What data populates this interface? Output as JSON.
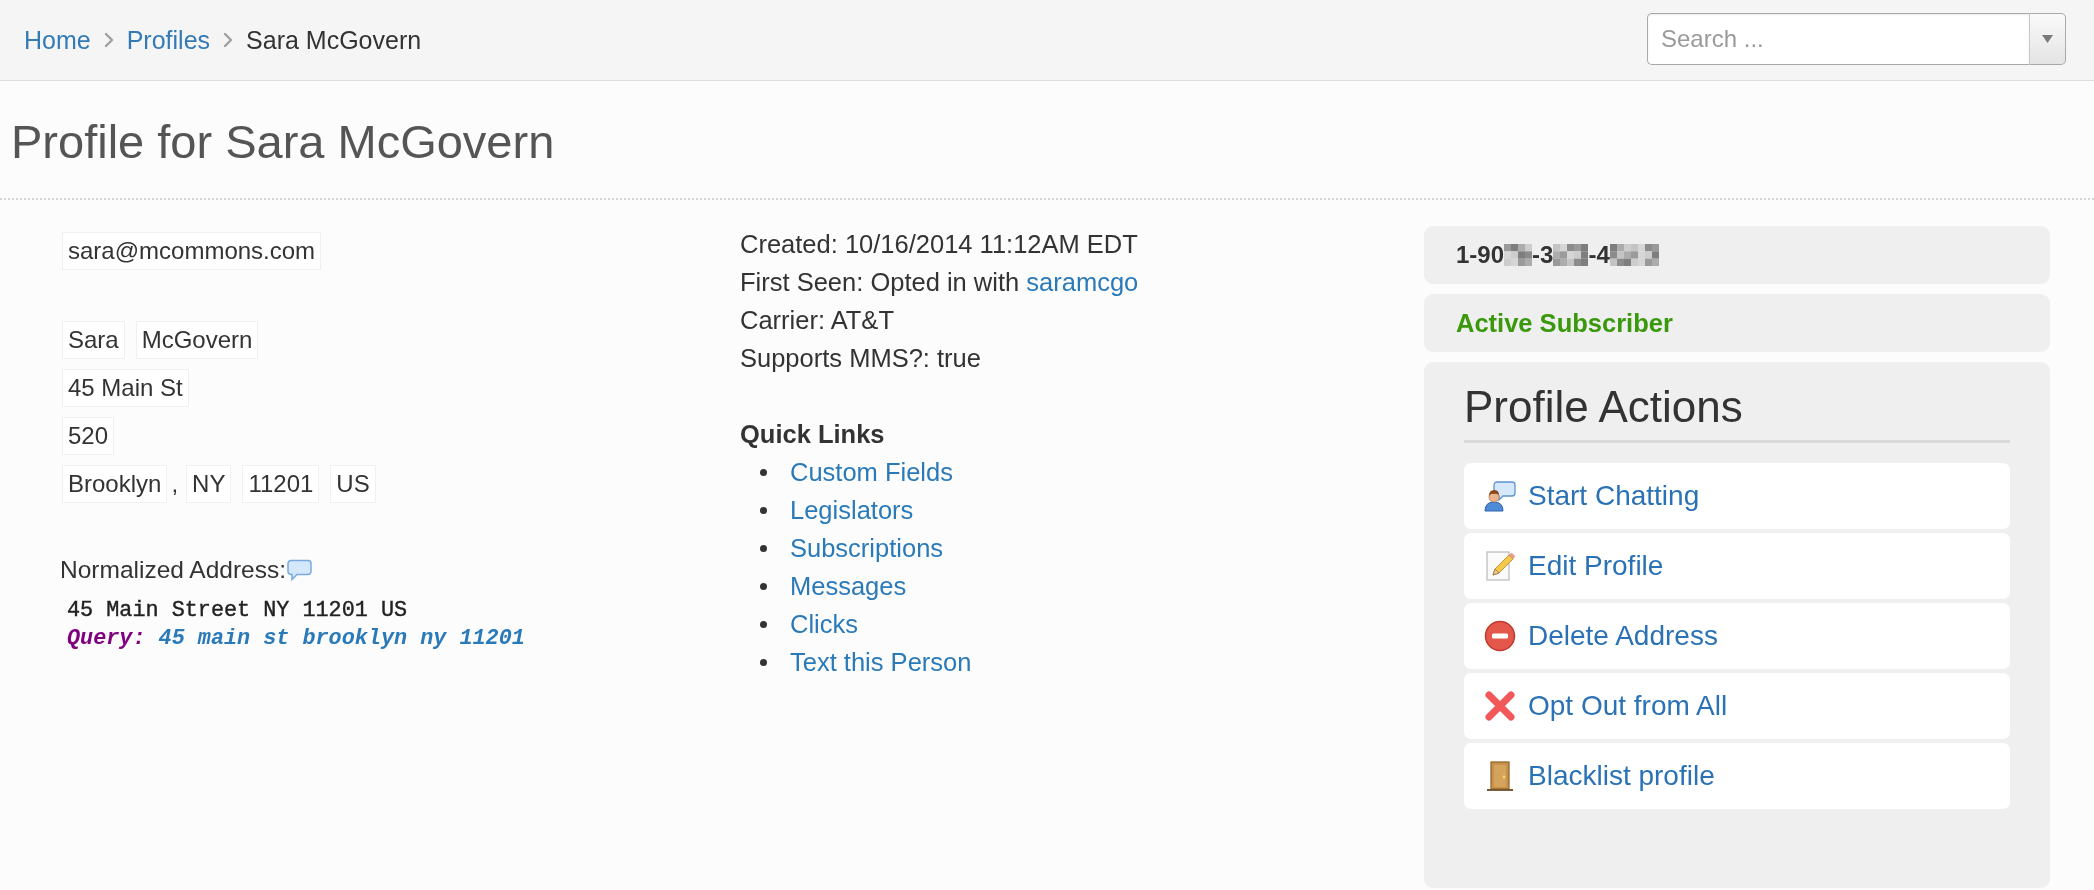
{
  "breadcrumb": [
    {
      "label": "Home",
      "kind": "link"
    },
    {
      "label": "Profiles",
      "kind": "link"
    },
    {
      "label": "Sara McGovern",
      "kind": "current"
    }
  ],
  "search": {
    "placeholder": "Search ..."
  },
  "page_title": "Profile for Sara McGovern",
  "contact": {
    "email": "sara@mcommons.com",
    "first_name": "Sara",
    "last_name": "McGovern",
    "street": "45 Main St",
    "street_2": "520",
    "city": "Brooklyn",
    "city_separator": ",",
    "state": "NY",
    "postal_code": "11201",
    "country": "US"
  },
  "normalized_address": {
    "label": "Normalized Address:",
    "address": "45 Main Street NY 11201 US",
    "query_label": "Query:",
    "query": "45 main st brooklyn ny 11201"
  },
  "details": [
    {
      "text": "Created: 10/16/2014 11:12AM EDT"
    },
    {
      "text": "First Seen: Opted in with",
      "link": "saramcgo"
    },
    {
      "text": "Carrier: AT&T"
    },
    {
      "text": "Supports MMS?: true"
    }
  ],
  "quick_links": {
    "title": "Quick Links",
    "items": [
      "Custom Fields",
      "Legislators",
      "Subscriptions",
      "Messages",
      "Clicks",
      "Text this Person"
    ]
  },
  "phone": {
    "segments": [
      {
        "kind": "digits",
        "text": "1-90"
      },
      {
        "kind": "blur"
      },
      {
        "kind": "digits",
        "text": "-3"
      },
      {
        "kind": "blur"
      },
      {
        "kind": "digits",
        "text": "-4"
      },
      {
        "kind": "blur"
      }
    ]
  },
  "status": {
    "label": "Active Subscriber",
    "kind": "active"
  },
  "profile_actions": {
    "title": "Profile Actions",
    "items": [
      {
        "label": "Start Chatting",
        "kind": "chat"
      },
      {
        "label": "Edit Profile",
        "kind": "edit"
      },
      {
        "label": "Delete Address",
        "kind": "delete"
      },
      {
        "label": "Opt Out from All",
        "kind": "opt_out"
      },
      {
        "label": "Blacklist profile",
        "kind": "blacklist"
      }
    ]
  }
}
